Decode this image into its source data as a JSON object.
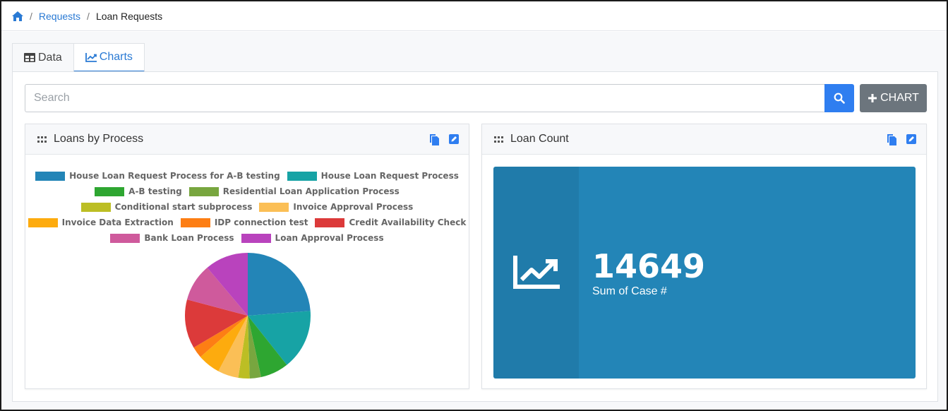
{
  "breadcrumb": {
    "home_icon": "home-icon",
    "items": [
      "Requests",
      "Loan Requests"
    ]
  },
  "tabs": [
    {
      "label": "Data",
      "icon": "table-icon",
      "active": false
    },
    {
      "label": "Charts",
      "icon": "line-chart-icon",
      "active": true
    }
  ],
  "search": {
    "placeholder": "Search",
    "value": ""
  },
  "add_chart_button": {
    "label": "CHART",
    "icon": "plus-icon"
  },
  "colors": {
    "accent": "#2f7ef0",
    "link": "#2a7ad4",
    "tile": "#2385b7",
    "secondary": "#6c757d"
  },
  "cards": [
    {
      "title": "Loans by Process",
      "icons": [
        "grip-icon",
        "copy-icon",
        "edit-icon"
      ]
    },
    {
      "title": "Loan Count",
      "icons": [
        "grip-icon",
        "copy-icon",
        "edit-icon"
      ]
    }
  ],
  "count_tile": {
    "value": "14649",
    "label": "Sum of Case #",
    "icon": "line-chart-icon"
  },
  "chart_data": {
    "type": "pie",
    "legend_position": "top",
    "series": [
      {
        "name": "House Loan Request Process for A-B testing",
        "value": 24.5,
        "color": "#2385b7"
      },
      {
        "name": "House Loan Request Process",
        "value": 16.0,
        "color": "#17a3a5"
      },
      {
        "name": "A-B testing",
        "value": 7.5,
        "color": "#2ea631"
      },
      {
        "name": "Residential Loan Application Process",
        "value": 3.0,
        "color": "#78a63f"
      },
      {
        "name": "Conditional start subprocess",
        "value": 3.0,
        "color": "#bcbe24"
      },
      {
        "name": "Invoice Approval Process",
        "value": 5.5,
        "color": "#fbbf56"
      },
      {
        "name": "Invoice Data Extraction",
        "value": 6.0,
        "color": "#fdab0e"
      },
      {
        "name": "IDP connection test",
        "value": 3.0,
        "color": "#fd7e14"
      },
      {
        "name": "Credit Availability Check",
        "value": 13.0,
        "color": "#dc3a3a"
      },
      {
        "name": "Bank Loan Process",
        "value": 10.0,
        "color": "#cf5a9c"
      },
      {
        "name": "Loan Approval Process",
        "value": 11.5,
        "color": "#b943bd"
      }
    ]
  }
}
